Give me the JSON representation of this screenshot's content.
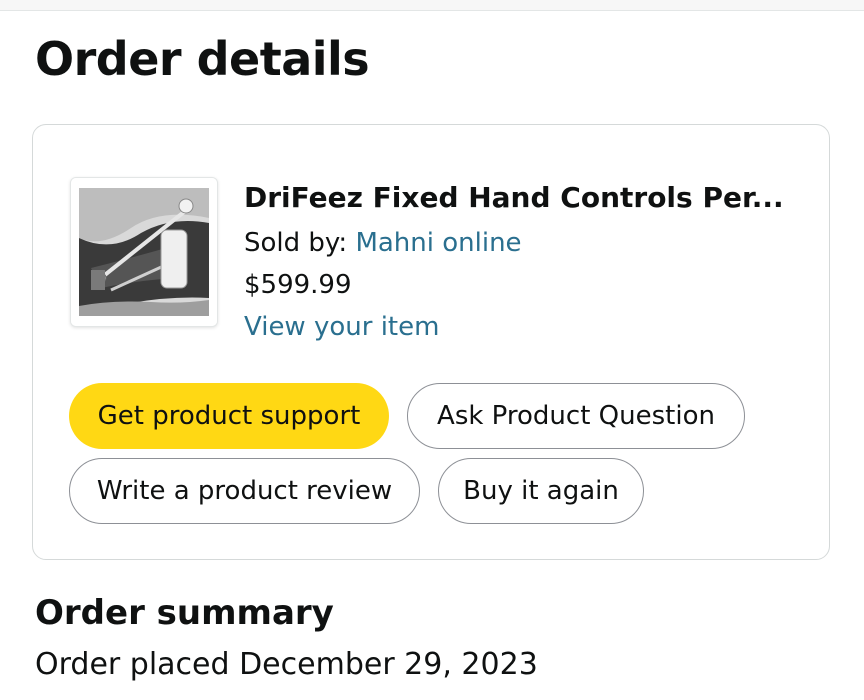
{
  "page": {
    "title": "Order details"
  },
  "item": {
    "image_icon": "product-photo-hand-controls",
    "title": "DriFeez Fixed Hand Controls Per...",
    "sold_by_label": "Sold by: ",
    "seller": "Mahni online",
    "price": "$599.99",
    "view_link": "View your item"
  },
  "actions": {
    "get_support": "Get product support",
    "ask_question": "Ask Product Question",
    "write_review": "Write a product review",
    "buy_again": "Buy it again"
  },
  "summary": {
    "title": "Order summary",
    "order_placed": "Order placed December 29, 2023"
  },
  "colors": {
    "primary_button": "#ffd814",
    "link": "#2a6f8f",
    "text": "#0f1111",
    "border": "#d5d9d9"
  }
}
